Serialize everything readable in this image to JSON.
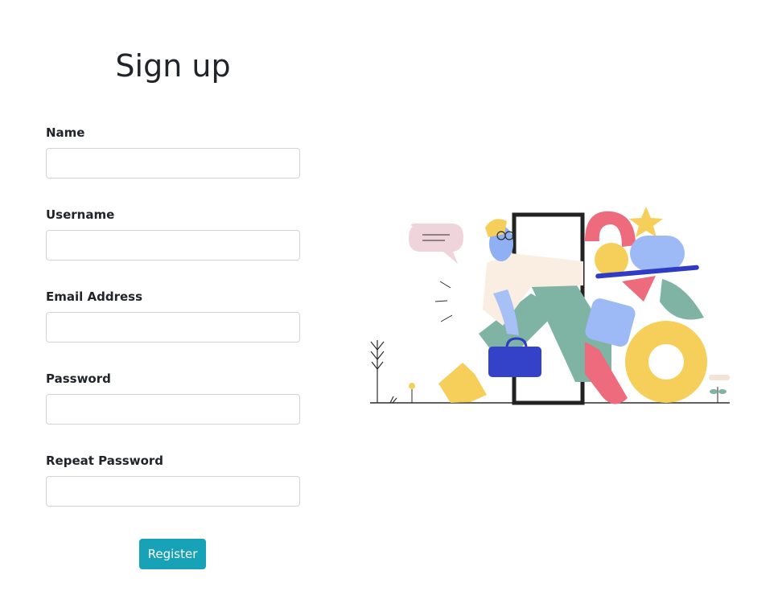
{
  "page": {
    "title": "Sign up"
  },
  "form": {
    "fields": [
      {
        "label": "Name",
        "value": "",
        "placeholder": ""
      },
      {
        "label": "Username",
        "value": "",
        "placeholder": ""
      },
      {
        "label": "Email Address",
        "value": "",
        "placeholder": ""
      },
      {
        "label": "Password",
        "value": "",
        "placeholder": ""
      },
      {
        "label": "Repeat Password",
        "value": "",
        "placeholder": ""
      }
    ],
    "submit_label": "Register"
  },
  "colors": {
    "button": "#17a2b8",
    "input_border": "#ced4da",
    "text": "#212529"
  },
  "illustration": {
    "icon": "person-walking-through-door-illustration"
  }
}
